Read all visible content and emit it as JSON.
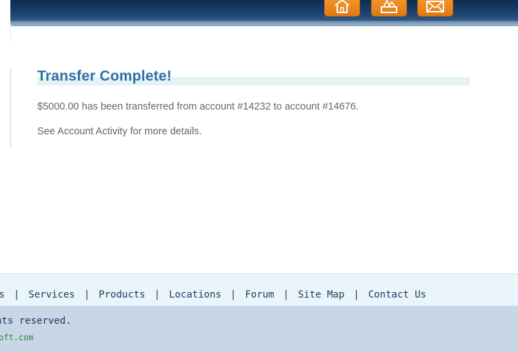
{
  "header": {
    "buttons": [
      {
        "name": "home",
        "icon": "home-icon"
      },
      {
        "name": "sitemap",
        "icon": "sitemap-icon"
      },
      {
        "name": "contact",
        "icon": "envelope-icon"
      }
    ],
    "accent": "#e9811a"
  },
  "content": {
    "title": "Transfer Complete!",
    "message": "$5000.00 has been transferred from account #14232 to account #14676.",
    "details_link": "See Account Activity",
    "details_suffix": " for more details."
  },
  "footer": {
    "nav": {
      "about": "Us",
      "services": "Services",
      "products": "Products",
      "locations": "Locations",
      "forum": "Forum",
      "sitemap": "Site Map",
      "contact": "Contact Us",
      "separator": "|"
    },
    "copyright": "nts reserved.",
    "site": "oft.com"
  },
  "colors": {
    "title": "#2d6fa6",
    "body_text": "#666666",
    "footer_text": "#1e3a5a",
    "footer_link": "#2f8a3a"
  }
}
